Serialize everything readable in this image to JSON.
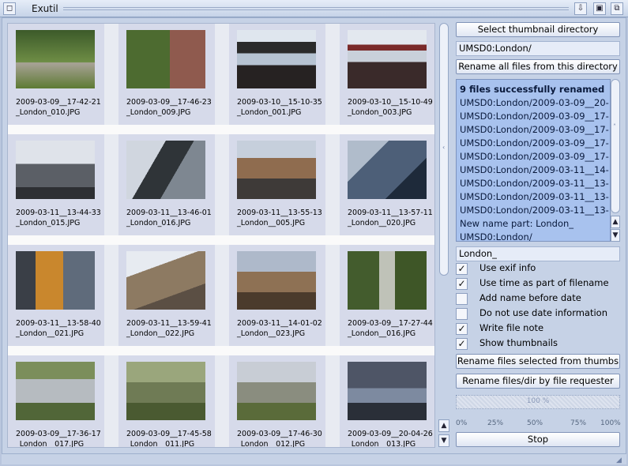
{
  "window": {
    "title": "Exutil",
    "close_glyph": "◻",
    "btn_depth": "⇩",
    "btn_zoom": "▣",
    "btn_iconify": "⧉"
  },
  "thumbnails": [
    {
      "caption": "2009-03-09__17-42-21\n_London_010.JPG"
    },
    {
      "caption": "2009-03-09__17-46-23\n_London_009.JPG"
    },
    {
      "caption": "2009-03-10__15-10-35\n_London_001.JPG"
    },
    {
      "caption": "2009-03-10__15-10-49\n_London_003.JPG"
    },
    {
      "caption": "2009-03-11__13-44-33\n_London_015.JPG"
    },
    {
      "caption": "2009-03-11__13-46-01\n_London_016.JPG"
    },
    {
      "caption": "2009-03-11__13-55-13\n_London__005.JPG"
    },
    {
      "caption": "2009-03-11__13-57-11\n_London__020.JPG"
    },
    {
      "caption": "2009-03-11__13-58-40\n_London__021.JPG"
    },
    {
      "caption": "2009-03-11__13-59-41\n_London__022.JPG"
    },
    {
      "caption": "2009-03-11__14-01-02\n_London__023.JPG"
    },
    {
      "caption": "2009-03-09__17-27-44\n_London__016.JPG"
    },
    {
      "caption": "2009-03-09__17-36-17\n_London__017.JPG"
    },
    {
      "caption": "2009-03-09__17-45-58\n_London__011.JPG"
    },
    {
      "caption": "2009-03-09__17-46-30\n_London__012.JPG"
    },
    {
      "caption": "2009-03-09__20-04-26\n_London__013.JPG"
    }
  ],
  "panel": {
    "select_dir_label": "Select thumbnail directory",
    "dir_path": "UMSD0:London/",
    "rename_all_label": "Rename all files from this directory",
    "log_lines": [
      "9 files successfully renamed",
      "UMSD0:London/2009-03-09__20-",
      "UMSD0:London/2009-03-09__17-",
      "UMSD0:London/2009-03-09__17-",
      "UMSD0:London/2009-03-09__17-",
      "UMSD0:London/2009-03-09__17-",
      "UMSD0:London/2009-03-11__14-",
      "UMSD0:London/2009-03-11__13-",
      "UMSD0:London/2009-03-11__13-",
      "UMSD0:London/2009-03-11__13-",
      "New name part: London_",
      "UMSD0:London/"
    ],
    "name_part": "London_",
    "options": [
      {
        "label": "Use exif info",
        "checked": true
      },
      {
        "label": "Use time as part of filename",
        "checked": true
      },
      {
        "label": "Add name before date",
        "checked": false
      },
      {
        "label": "Do not use date information",
        "checked": false
      },
      {
        "label": "Write file note",
        "checked": true
      },
      {
        "label": "Show thumbnails",
        "checked": true
      }
    ],
    "rename_selected_label": "Rename files selected from thumbs",
    "rename_requester_label": "Rename files/dir by file requester",
    "progress_text": "100 %",
    "progress_value": 100,
    "progress_ticks": [
      "0%",
      "25%",
      "50%",
      "75%",
      "100%"
    ],
    "stop_label": "Stop",
    "check_glyph": "✓",
    "up_glyph": "▲",
    "down_glyph": "▼"
  }
}
